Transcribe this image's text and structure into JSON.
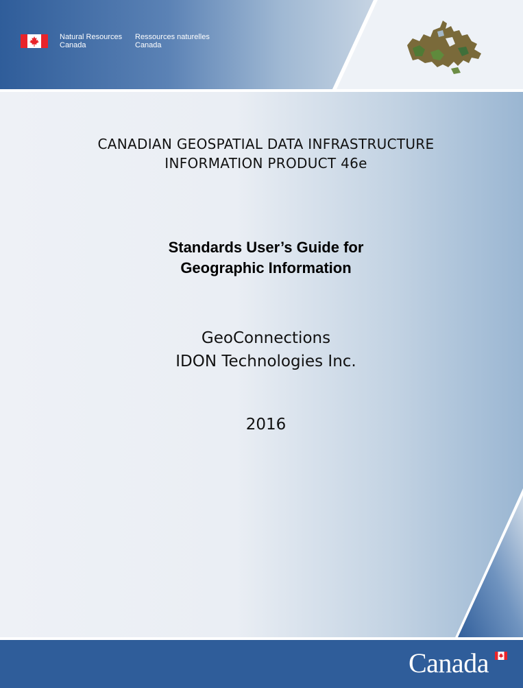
{
  "header": {
    "department_en": [
      "Natural Resources",
      "Canada"
    ],
    "department_fr": [
      "Ressources naturelles",
      "Canada"
    ],
    "map_icon": "canada-map-icon",
    "flag_icon": "canada-flag-icon"
  },
  "document": {
    "title_lines": [
      "CANADIAN GEOSPATIAL DATA INFRASTRUCTURE",
      "INFORMATION PRODUCT 46e"
    ],
    "subtitle_lines": [
      "Standards User’s Guide for",
      "Geographic Information"
    ],
    "author_lines": [
      "GeoConnections",
      "IDON Technologies Inc."
    ],
    "year": "2016"
  },
  "footer": {
    "wordmark": "Canada"
  },
  "colors": {
    "brand_blue": "#2f5d9a",
    "flag_red": "#e8242b"
  }
}
